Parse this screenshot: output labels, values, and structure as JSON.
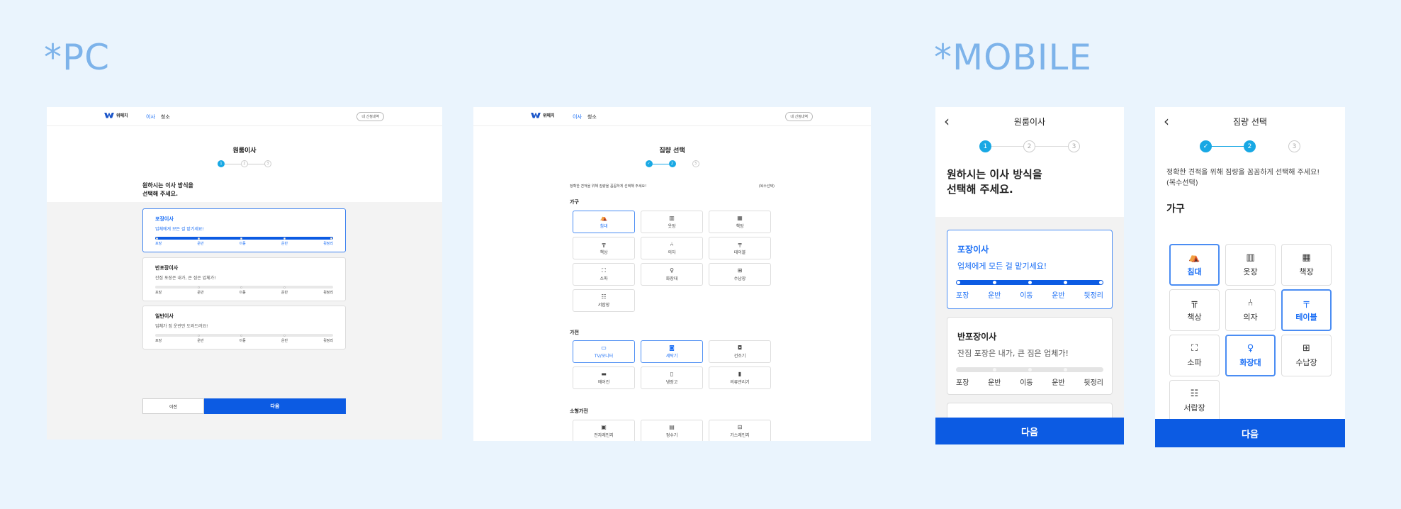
{
  "labels": {
    "pc": "*PC",
    "mobile": "*MOBILE"
  },
  "nav": {
    "brand": "위메치",
    "links": [
      "이사",
      "청소"
    ],
    "my_button": "내 신청내역"
  },
  "pc1": {
    "title": "원룸이사",
    "steps": [
      "1",
      "2",
      "3"
    ],
    "question_line1": "원하시는 이사 방식을",
    "question_line2": "선택해 주세요.",
    "options": [
      {
        "title": "포장이사",
        "subtitle": "업체에게 모든 걸 맡기세요!",
        "progress_fill": 1.0
      },
      {
        "title": "반포장이사",
        "subtitle": "잔짐 포장은 내가, 큰 짐은 업체가!",
        "progress_fill": 0.0
      },
      {
        "title": "일반이사",
        "subtitle": "업체가 짐 운반만 도와드려요!",
        "progress_fill": 0.0
      }
    ],
    "stage_labels": [
      "포장",
      "운반",
      "이동",
      "운반",
      "뒷정리"
    ],
    "prev_button": "이전",
    "next_button": "다음"
  },
  "pc2": {
    "title": "짐량 선택",
    "steps": [
      "✓",
      "2",
      "3"
    ],
    "note": "정확한 견적을 위해 짐량을 꼼꼼하게 선택해 주세요!",
    "multi": "(복수선택)",
    "categories": [
      {
        "name": "가구",
        "items": [
          {
            "label": "침대",
            "icon": "bed-icon",
            "glyph": "⛺"
          },
          {
            "label": "옷장",
            "icon": "wardrobe-icon",
            "glyph": "▥"
          },
          {
            "label": "책장",
            "icon": "bookshelf-icon",
            "glyph": "▦"
          },
          {
            "label": "책상",
            "icon": "desk-icon",
            "glyph": "╦"
          },
          {
            "label": "의자",
            "icon": "chair-icon",
            "glyph": "⑃"
          },
          {
            "label": "테이블",
            "icon": "table-icon",
            "glyph": "╤"
          },
          {
            "label": "소파",
            "icon": "sofa-icon",
            "glyph": "⛶"
          },
          {
            "label": "화장대",
            "icon": "vanity-icon",
            "glyph": "♀"
          },
          {
            "label": "수납장",
            "icon": "cabinet-icon",
            "glyph": "⊞"
          },
          {
            "label": "서랍장",
            "icon": "drawer-icon",
            "glyph": "☷"
          }
        ]
      },
      {
        "name": "가전",
        "items": [
          {
            "label": "TV/모니터",
            "icon": "tv-icon",
            "glyph": "▭"
          },
          {
            "label": "세탁기",
            "icon": "washer-icon",
            "glyph": "◙"
          },
          {
            "label": "건조기",
            "icon": "dryer-icon",
            "glyph": "◘"
          },
          {
            "label": "에어컨",
            "icon": "aircon-icon",
            "glyph": "▬"
          },
          {
            "label": "냉장고",
            "icon": "fridge-icon",
            "glyph": "▯"
          },
          {
            "label": "의류관리기",
            "icon": "clothes-care-icon",
            "glyph": "▮"
          }
        ]
      },
      {
        "name": "소형가전",
        "items": [
          {
            "label": "전자레인지",
            "icon": "microwave-icon",
            "glyph": "▣"
          },
          {
            "label": "정수기",
            "icon": "water-purifier-icon",
            "glyph": "▤"
          },
          {
            "label": "가스레인지",
            "icon": "gas-range-icon",
            "glyph": "⊟"
          }
        ]
      }
    ]
  },
  "m1": {
    "title": "원룸이사",
    "steps": [
      "1",
      "2",
      "3"
    ],
    "question_line1": "원하시는 이사 방식을",
    "question_line2": "선택해 주세요.",
    "options": [
      {
        "title": "포장이사",
        "subtitle": "업체에게 모든 걸 맡기세요!",
        "progress_fill": 1.0
      },
      {
        "title": "반포장이사",
        "subtitle": "잔짐 포장은 내가, 큰 짐은 업체가!",
        "progress_fill": 0.0
      }
    ],
    "stage_labels": [
      "포장",
      "운반",
      "이동",
      "운반",
      "뒷정리"
    ],
    "next_button": "다음"
  },
  "m2": {
    "title": "짐량 선택",
    "steps": [
      "✓",
      "2",
      "3"
    ],
    "note_line1": "정확한 견적을 위해 짐량을 꼼꼼하게 선택해 주세요!",
    "note_line2": "(복수선택)",
    "category": "가구",
    "items": [
      {
        "label": "침대",
        "icon": "bed-icon",
        "glyph": "⛺"
      },
      {
        "label": "옷장",
        "icon": "wardrobe-icon",
        "glyph": "▥"
      },
      {
        "label": "책장",
        "icon": "bookshelf-icon",
        "glyph": "▦"
      },
      {
        "label": "책상",
        "icon": "desk-icon",
        "glyph": "╦"
      },
      {
        "label": "의자",
        "icon": "chair-icon",
        "glyph": "⑃"
      },
      {
        "label": "테이블",
        "icon": "table-icon",
        "glyph": "╤"
      },
      {
        "label": "소파",
        "icon": "sofa-icon",
        "glyph": "⛶"
      },
      {
        "label": "화장대",
        "icon": "vanity-icon",
        "glyph": "♀"
      },
      {
        "label": "수납장",
        "icon": "cabinet-icon",
        "glyph": "⊞"
      },
      {
        "label": "서랍장",
        "icon": "drawer-icon",
        "glyph": "☷"
      }
    ],
    "next_button": "다음"
  },
  "colors": {
    "accent": "#0c5be3",
    "step": "#18a8e4",
    "label": "#7db3ea"
  }
}
